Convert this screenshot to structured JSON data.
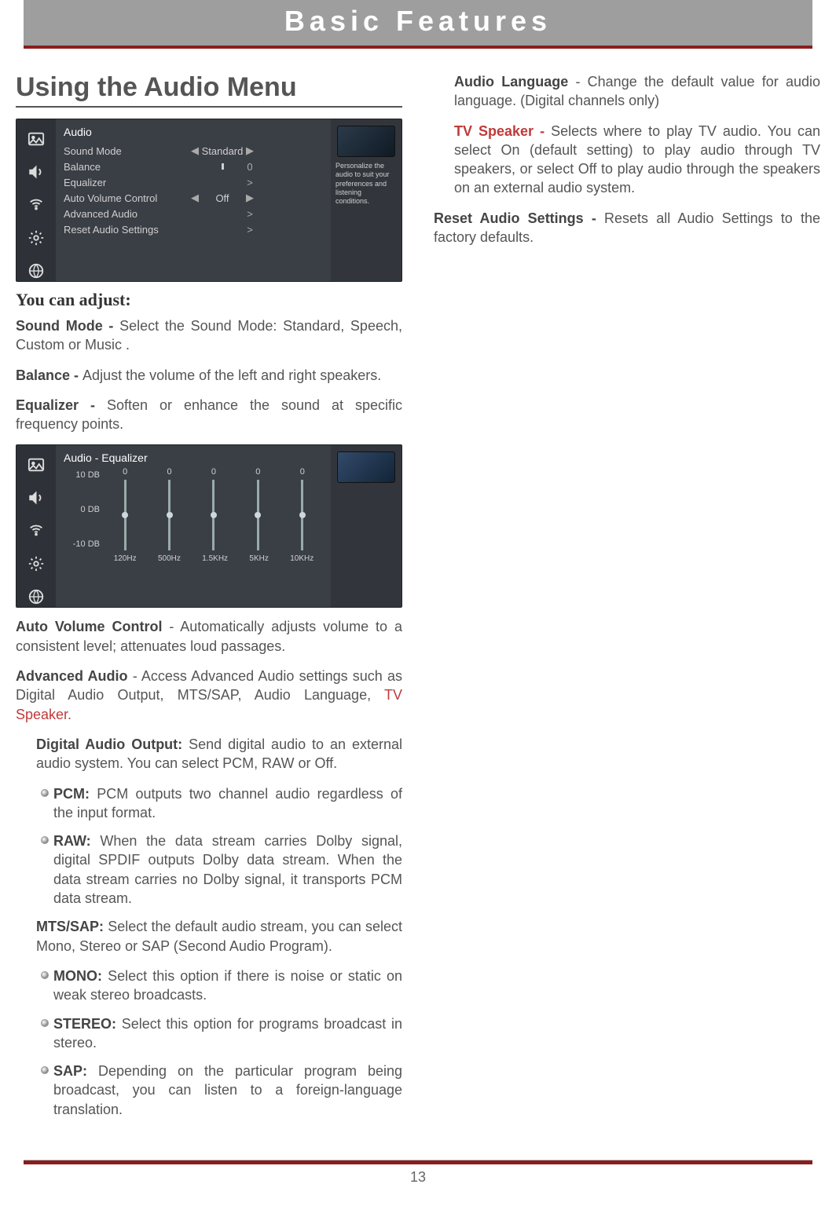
{
  "chapter": "Basic Features",
  "page_number": "13",
  "section_title": "Using the Audio Menu",
  "audio_menu": {
    "title": "Audio",
    "rows": [
      {
        "label": "Sound Mode",
        "left_arrow": "◀",
        "value": "Standard",
        "right": "▶"
      },
      {
        "label": "Balance",
        "left_arrow": "",
        "value": "",
        "right": "0"
      },
      {
        "label": "Equalizer",
        "left_arrow": "",
        "value": "",
        "right": ">"
      },
      {
        "label": "Auto Volume Control",
        "left_arrow": "◀",
        "value": "Off",
        "right": "▶"
      },
      {
        "label": "Advanced Audio",
        "left_arrow": "",
        "value": "",
        "right": ">"
      },
      {
        "label": "Reset Audio Settings",
        "left_arrow": "",
        "value": "",
        "right": ">"
      }
    ],
    "help": "Personalize the audio to suit your preferences and listening conditions."
  },
  "subhead": "You can adjust:",
  "para_sound_mode_label": "Sound Mode - ",
  "para_sound_mode_text": "Select the Sound Mode: Standard, Speech, Custom or Music .",
  "para_balance_label": "Balance - ",
  "para_balance_text": "Adjust the volume of the left and right speakers.",
  "para_equalizer_label": "Equalizer - ",
  "para_equalizer_text": "Soften or enhance the sound at specific frequency points.",
  "equalizer_panel": {
    "title": "Audio - Equalizer",
    "ylabels": [
      "10 DB",
      "0 DB",
      "-10 DB"
    ],
    "xlabels": [
      "120Hz",
      "500Hz",
      "1.5KHz",
      "5KHz",
      "10KHz"
    ],
    "topvals": [
      "0",
      "0",
      "0",
      "0",
      "0"
    ]
  },
  "chart_data": {
    "type": "bar",
    "title": "Audio - Equalizer",
    "categories": [
      "120Hz",
      "500Hz",
      "1.5KHz",
      "5KHz",
      "10KHz"
    ],
    "values": [
      0,
      0,
      0,
      0,
      0
    ],
    "ylabel": "DB",
    "ylim": [
      -10,
      10
    ]
  },
  "para_avc_label": "Auto Volume Control",
  "para_avc_text": " - Automatically adjusts volume to a consistent level; attenuates loud passages.",
  "para_adv_label": "Advanced Audio",
  "para_adv_text1": " - Access Advanced Audio settings such as Digital Audio Output, MTS/SAP, Audio Language, ",
  "para_adv_red": "TV Speaker.",
  "dao_label": "Digital Audio Output: ",
  "dao_text": "Send digital audio to an external audio system. You can select PCM, RAW or Off.",
  "pcm_label": "PCM: ",
  "pcm_text": "PCM outputs two channel audio regardless of the input format.",
  "raw_label": "RAW: ",
  "raw_text": "When the data stream carries Dolby signal, digital SPDIF outputs Dolby data stream. When the data stream carries no Dolby signal, it transports PCM data stream.",
  "mts_label": "MTS/SAP: ",
  "mts_text": "Select the default audio stream, you can select Mono, Stereo or SAP (Second Audio Program).",
  "mono_label": "MONO: ",
  "mono_text": "Select this option if there is noise or static on weak stereo broadcasts.",
  "stereo_label": "STEREO: ",
  "stereo_text": "Select this option for programs broadcast in stereo.",
  "sap_label": "SAP: ",
  "sap_text": "Depending on the particular program being broadcast, you can listen to a foreign-language translation.",
  "col2": {
    "al_label": "Audio Language",
    "al_text": " - Change the default value for audio language. (Digital channels only)",
    "tvs_label": "TV Speaker - ",
    "tvs_text": "Selects where to play TV audio. You can select On (default setting) to play audio through TV speakers, or select Off to play audio through the speakers on an external audio system.",
    "reset_label": "Reset Audio Settings - ",
    "reset_text": "Resets all Audio Settings to the factory defaults."
  }
}
